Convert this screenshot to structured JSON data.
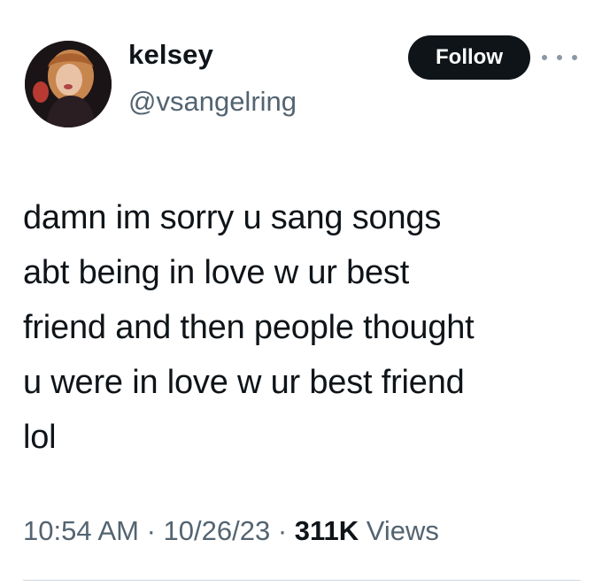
{
  "user": {
    "display_name": "kelsey",
    "handle": "@vsangelring",
    "avatar": "profile-photo"
  },
  "actions": {
    "follow_label": "Follow",
    "more_icon": "more-horizontal-icon"
  },
  "tweet": {
    "text": "damn im sorry u sang songs\nabt being in love w ur best\nfriend and then people thought\nu were in love w ur best friend\nlol"
  },
  "meta": {
    "time": "10:54 AM",
    "separator": " · ",
    "date": "10/26/23",
    "views_count": "311K",
    "views_label": " Views"
  },
  "colors": {
    "text_primary": "#0f1419",
    "text_secondary": "#536471",
    "button_bg": "#0f1419",
    "divider": "#cfd9de"
  }
}
